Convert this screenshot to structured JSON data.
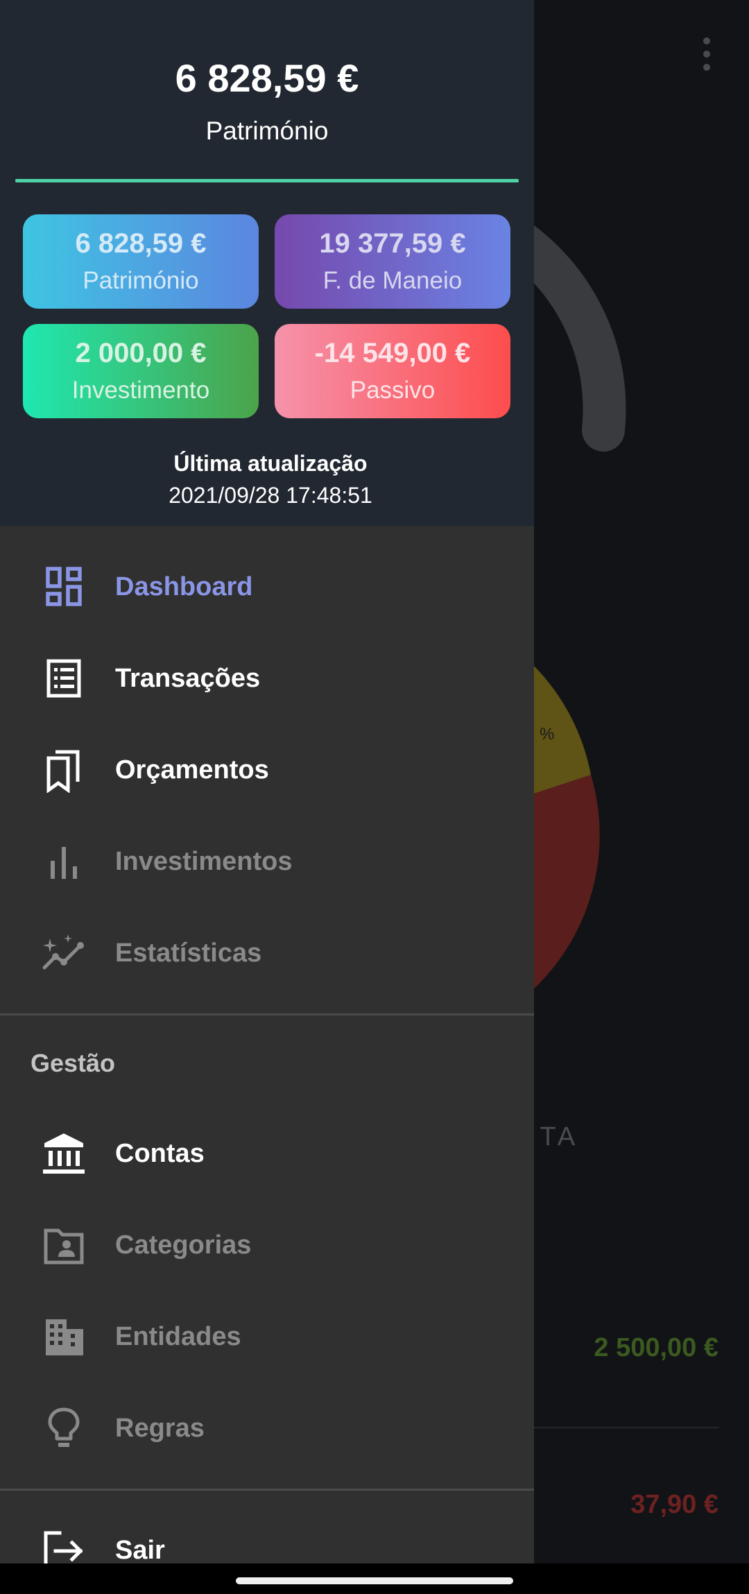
{
  "background": {
    "receita_label": "CEITA",
    "pie_percent_label": "%",
    "income_value": "2 500,00 €",
    "expense_value": "37,90 €",
    "colors": {
      "pie_yellow": "#5f5316",
      "pie_red": "#5a1f1d",
      "gauge": "#3a3b3e"
    }
  },
  "drawer": {
    "header": {
      "net_amount": "6 828,59 €",
      "net_label": "Património",
      "accent_color": "#4fd1a5",
      "cards": {
        "patrimonio": {
          "amount": "6 828,59 €",
          "label": "Património"
        },
        "maneio": {
          "amount": "19 377,59 €",
          "label": "F. de Maneio"
        },
        "investimento": {
          "amount": "2 000,00 €",
          "label": "Investimento"
        },
        "passivo": {
          "amount": "-14 549,00 €",
          "label": "Passivo"
        }
      },
      "last_update_title": "Última atualização",
      "last_update_time": "2021/09/28 17:48:51"
    },
    "main_nav": [
      {
        "label": "Dashboard",
        "icon": "dashboard-icon",
        "state": "active"
      },
      {
        "label": "Transações",
        "icon": "receipt-list-icon",
        "state": "enabled"
      },
      {
        "label": "Orçamentos",
        "icon": "bookmarks-icon",
        "state": "enabled"
      },
      {
        "label": "Investimentos",
        "icon": "bar-chart-icon",
        "state": "disabled"
      },
      {
        "label": "Estatísticas",
        "icon": "trending-sparkle-icon",
        "state": "disabled"
      }
    ],
    "management": {
      "title": "Gestão",
      "items": [
        {
          "label": "Contas",
          "icon": "bank-icon",
          "state": "enabled"
        },
        {
          "label": "Categorias",
          "icon": "folder-person-icon",
          "state": "disabled"
        },
        {
          "label": "Entidades",
          "icon": "building-icon",
          "state": "disabled"
        },
        {
          "label": "Regras",
          "icon": "lightbulb-icon",
          "state": "disabled"
        }
      ]
    },
    "logout_label": "Sair",
    "colors": {
      "active": "#8a95e6",
      "enabled": "#ffffff",
      "disabled": "#8a8a8a"
    }
  }
}
